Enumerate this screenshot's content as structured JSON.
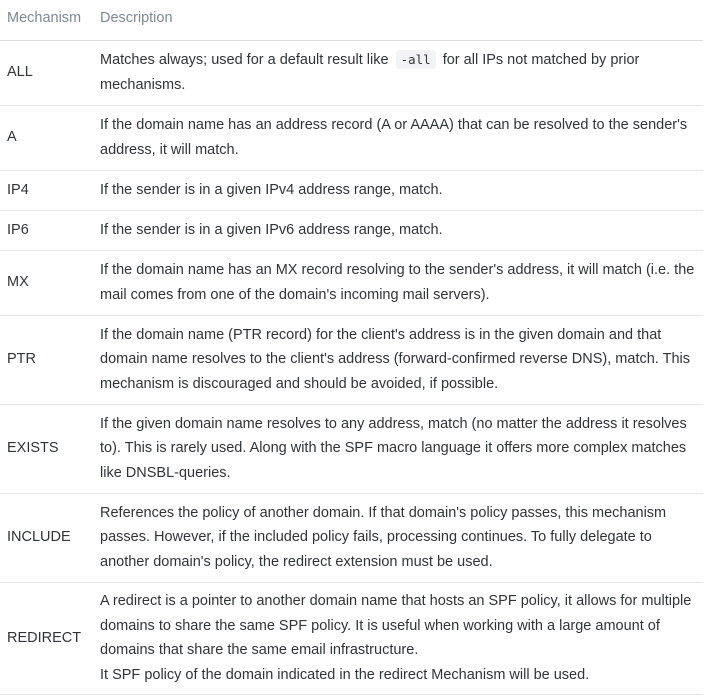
{
  "header": {
    "mechanism": "Mechanism",
    "description": "Description"
  },
  "rows": [
    {
      "mechanism": "ALL",
      "desc_before": "Matches always; used for a default result like",
      "code": "-all",
      "desc_after": "for all IPs not matched by prior mechanisms."
    },
    {
      "mechanism": "A",
      "description": "If the domain name has an address record (A or AAAA) that can be resolved to the sender's address, it will match."
    },
    {
      "mechanism": "IP4",
      "description": "If the sender is in a given IPv4 address range, match."
    },
    {
      "mechanism": "IP6",
      "description": "If the sender is in a given IPv6 address range, match."
    },
    {
      "mechanism": "MX",
      "description": "If the domain name has an MX record resolving to the sender's address, it will match (i.e. the mail comes from one of the domain's incoming mail servers)."
    },
    {
      "mechanism": "PTR",
      "description": "If the domain name (PTR record) for the client's address is in the given domain and that domain name resolves to the client's address (forward-confirmed reverse DNS), match. This mechanism is discouraged and should be avoided, if possible."
    },
    {
      "mechanism": "EXISTS",
      "description": "If the given domain name resolves to any address, match (no matter the address it resolves to). This is rarely used. Along with the SPF macro language it offers more complex matches like DNSBL-queries."
    },
    {
      "mechanism": "INCLUDE",
      "description": "References the policy of another domain. If that domain's policy passes, this mechanism passes. However, if the included policy fails, processing continues. To fully delegate to another domain's policy, the redirect extension must be used."
    },
    {
      "mechanism": "REDIRECT",
      "description": "A redirect is a pointer to another domain name that hosts an SPF policy, it allows for multiple domains to share the same SPF policy. It is useful when working with a large amount of domains that share the same email infrastructure.",
      "description_line2": "It SPF policy of the domain indicated in the redirect Mechanism will be used."
    }
  ]
}
